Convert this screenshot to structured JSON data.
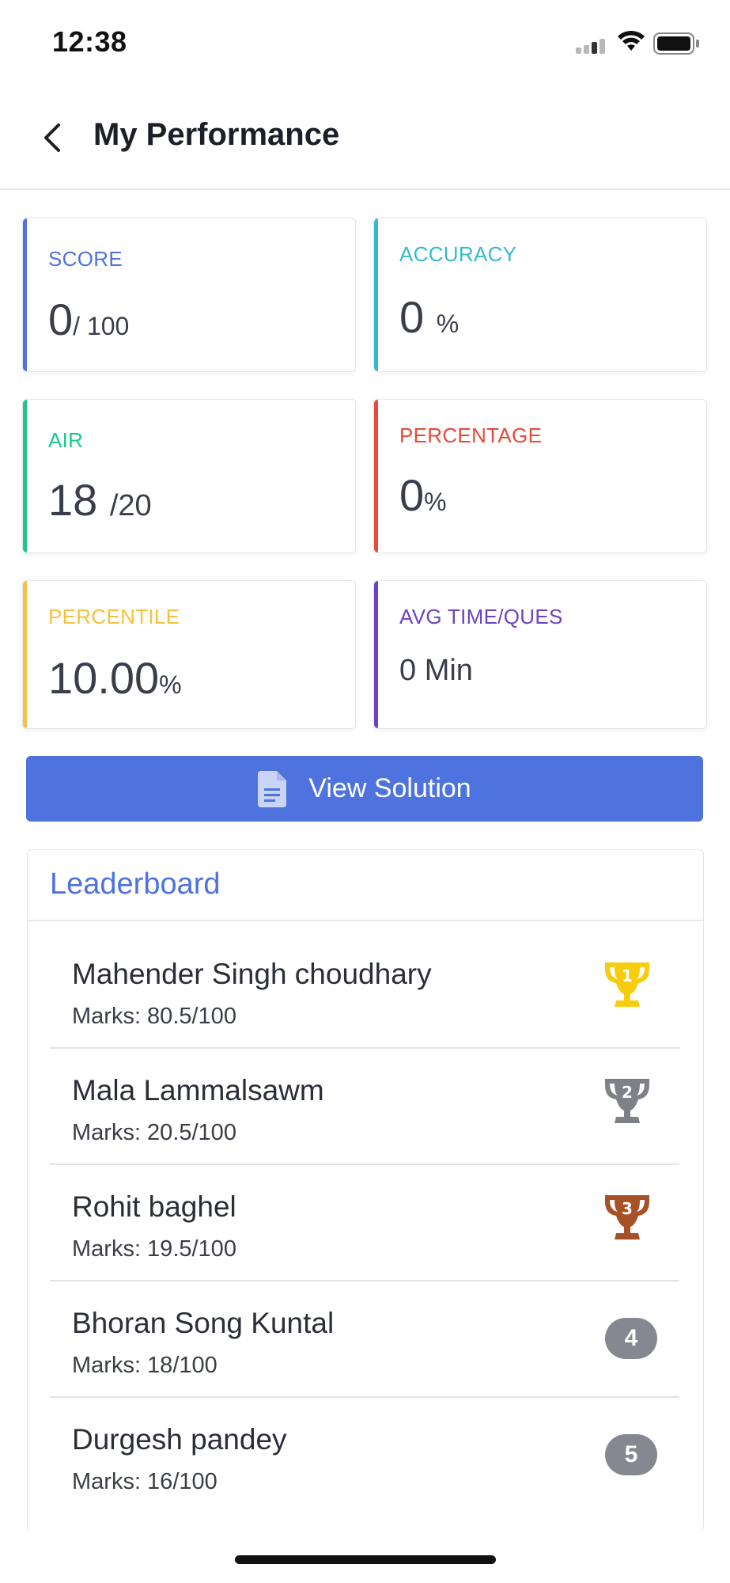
{
  "status_bar": {
    "time": "12:38"
  },
  "header": {
    "title": "My Performance"
  },
  "stats": {
    "score": {
      "label": "SCORE",
      "value": "0",
      "denominator": "/ 100"
    },
    "accuracy": {
      "label": "ACCURACY",
      "value": "0",
      "unit": "%"
    },
    "air": {
      "label": "AIR",
      "value": "18",
      "denominator": "/20"
    },
    "percentage": {
      "label": "PERCENTAGE",
      "value": "0",
      "unit": "%"
    },
    "percentile": {
      "label": "PERCENTILE",
      "value": "10.00",
      "unit": "%"
    },
    "avg_time": {
      "label": "AVG TIME/QUES",
      "value": "0 Min"
    }
  },
  "colors": {
    "score": "#4e73df",
    "accuracy": "#36b9cc",
    "air": "#1cc88a",
    "percentage": "#e74a3b",
    "percentile": "#f6c23e",
    "avg_time": "#6f42c1",
    "gold": "#f7cc0e",
    "silver": "#7f8189",
    "bronze": "#a65226"
  },
  "actions": {
    "view_solution": "View Solution"
  },
  "leaderboard": {
    "title": "Leaderboard",
    "entries": [
      {
        "name": "Mahender Singh choudhary",
        "marks": "Marks: 80.5/100",
        "rank": "1",
        "icon": "gold-trophy-icon"
      },
      {
        "name": "Mala Lammalsawm",
        "marks": "Marks: 20.5/100",
        "rank": "2",
        "icon": "silver-trophy-icon"
      },
      {
        "name": "Rohit baghel",
        "marks": "Marks: 19.5/100",
        "rank": "3",
        "icon": "bronze-trophy-icon"
      },
      {
        "name": "Bhoran Song Kuntal",
        "marks": "Marks: 18/100",
        "rank": "4"
      },
      {
        "name": "Durgesh pandey",
        "marks": "Marks: 16/100",
        "rank": "5"
      }
    ]
  }
}
